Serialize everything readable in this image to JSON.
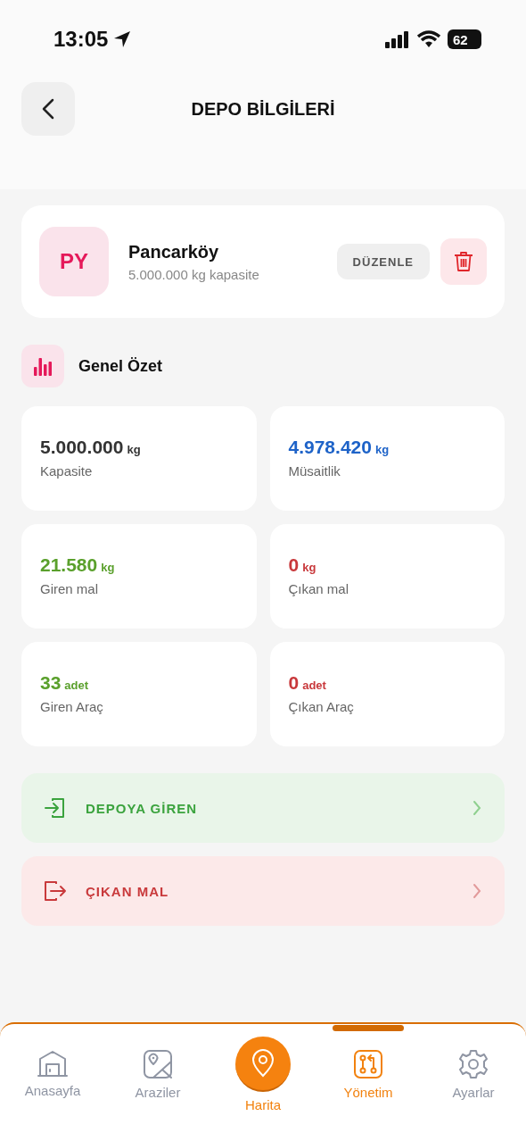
{
  "status_bar": {
    "time": "13:05",
    "battery": "62"
  },
  "header": {
    "title": "DEPO BİLGİLERİ"
  },
  "depot": {
    "initials": "PY",
    "name": "Pancarköy",
    "subtitle": "5.000.000 kg kapasite",
    "edit_label": "DÜZENLE"
  },
  "section": {
    "title": "Genel Özet"
  },
  "stats": [
    {
      "value": "5.000.000",
      "unit": "kg",
      "label": "Kapasite",
      "color": "#333333"
    },
    {
      "value": "4.978.420",
      "unit": "kg",
      "label": "Müsaitlik",
      "color": "#1e63c8"
    },
    {
      "value": "21.580",
      "unit": "kg",
      "label": "Giren mal",
      "color": "#5aa02c"
    },
    {
      "value": "0",
      "unit": "kg",
      "label": "Çıkan mal",
      "color": "#c8383b"
    },
    {
      "value": "33",
      "unit": "adet",
      "label": "Giren Araç",
      "color": "#5aa02c"
    },
    {
      "value": "0",
      "unit": "adet",
      "label": "Çıkan Araç",
      "color": "#c8383b"
    }
  ],
  "actions": [
    {
      "kind": "in",
      "label": "DEPOYA GİREN"
    },
    {
      "kind": "out",
      "label": "ÇIKAN MAL"
    }
  ],
  "bottom_nav": [
    {
      "kind": "home",
      "label": "Anasayfa",
      "selected": false
    },
    {
      "kind": "lands",
      "label": "Araziler",
      "selected": false
    },
    {
      "kind": "center",
      "label": "Harita"
    },
    {
      "kind": "manage",
      "label": "Yönetim",
      "selected": true
    },
    {
      "kind": "settings",
      "label": "Ayarlar",
      "selected": false
    }
  ]
}
